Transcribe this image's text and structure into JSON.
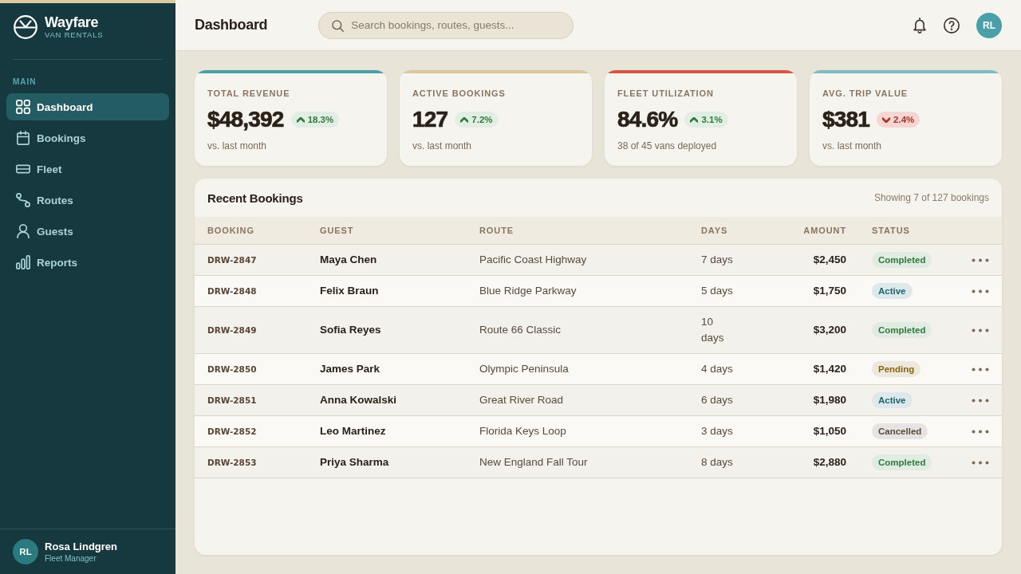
{
  "sidebar": {
    "brand": {
      "name": "Wayfare",
      "tagline": "VAN RENTALS"
    },
    "section_label": "MAIN",
    "items": [
      {
        "label": "Dashboard",
        "selected": true
      },
      {
        "label": "Bookings",
        "selected": false
      },
      {
        "label": "Fleet",
        "selected": false
      },
      {
        "label": "Routes",
        "selected": false
      },
      {
        "label": "Guests",
        "selected": false
      },
      {
        "label": "Reports",
        "selected": false
      }
    ],
    "user": {
      "initials": "RL",
      "name": "Rosa Lindgren",
      "role": "Fleet Manager"
    }
  },
  "header": {
    "title": "Dashboard",
    "search": {
      "placeholder": "Search bookings, routes, guests..."
    },
    "avatar": "RL"
  },
  "stats": [
    {
      "label": "TOTAL REVENUE",
      "value": "$48,392",
      "change": {
        "text": "18.3%",
        "kind": "up"
      },
      "note": "vs. last month",
      "color": "#4a9fab"
    },
    {
      "label": "ACTIVE BOOKINGS",
      "value": "127",
      "change": {
        "text": "7.2%",
        "kind": "up"
      },
      "note": "vs. last month",
      "color": "#d9c89e"
    },
    {
      "label": "FLEET UTILIZATION",
      "value": "84.6%",
      "change": {
        "text": "3.1%",
        "kind": "up"
      },
      "note": "38 of 45 vans deployed",
      "color": "#d65646"
    },
    {
      "label": "AVG. TRIP VALUE",
      "value": "$381",
      "change": {
        "text": "2.4%",
        "kind": "down"
      },
      "note": "vs. last month",
      "color": "#7dbcc5"
    }
  ],
  "bookings": {
    "title": "Recent Bookings",
    "summary": "Showing 7 of 127 bookings",
    "columns": [
      "BOOKING",
      "GUEST",
      "ROUTE",
      "DAYS",
      "AMOUNT",
      "STATUS"
    ],
    "rows": [
      {
        "booking": "DRW-2847",
        "guest": "Maya Chen",
        "route": "Pacific Coast Highway",
        "days": "7 days",
        "amount": "$2,450",
        "status": "Completed",
        "color": "#2e7a3c"
      },
      {
        "booking": "DRW-2848",
        "guest": "Felix Braun",
        "route": "Blue Ridge Parkway",
        "days": "5 days",
        "amount": "$1,750",
        "status": "Active",
        "color": "#1f6470"
      },
      {
        "booking": "DRW-2849",
        "guest": "Sofia Reyes",
        "route": "Route 66 Classic",
        "days": "10 days",
        "amount": "$3,200",
        "status": "Completed",
        "color": "#2e7a3c"
      },
      {
        "booking": "DRW-2850",
        "guest": "James Park",
        "route": "Olympic Peninsula",
        "days": "4 days",
        "amount": "$1,420",
        "status": "Pending",
        "color": "#8a6415"
      },
      {
        "booking": "DRW-2851",
        "guest": "Anna Kowalski",
        "route": "Great River Road",
        "days": "6 days",
        "amount": "$1,980",
        "status": "Active",
        "color": "#1f6470"
      },
      {
        "booking": "DRW-2852",
        "guest": "Leo Martinez",
        "route": "Florida Keys Loop",
        "days": "3 days",
        "amount": "$1,050",
        "status": "Cancelled",
        "color": "#5b4a3b"
      },
      {
        "booking": "DRW-2853",
        "guest": "Priya Sharma",
        "route": "New England Fall Tour",
        "days": "8 days",
        "amount": "$2,880",
        "status": "Completed",
        "color": "#2e7a3c"
      }
    ]
  }
}
